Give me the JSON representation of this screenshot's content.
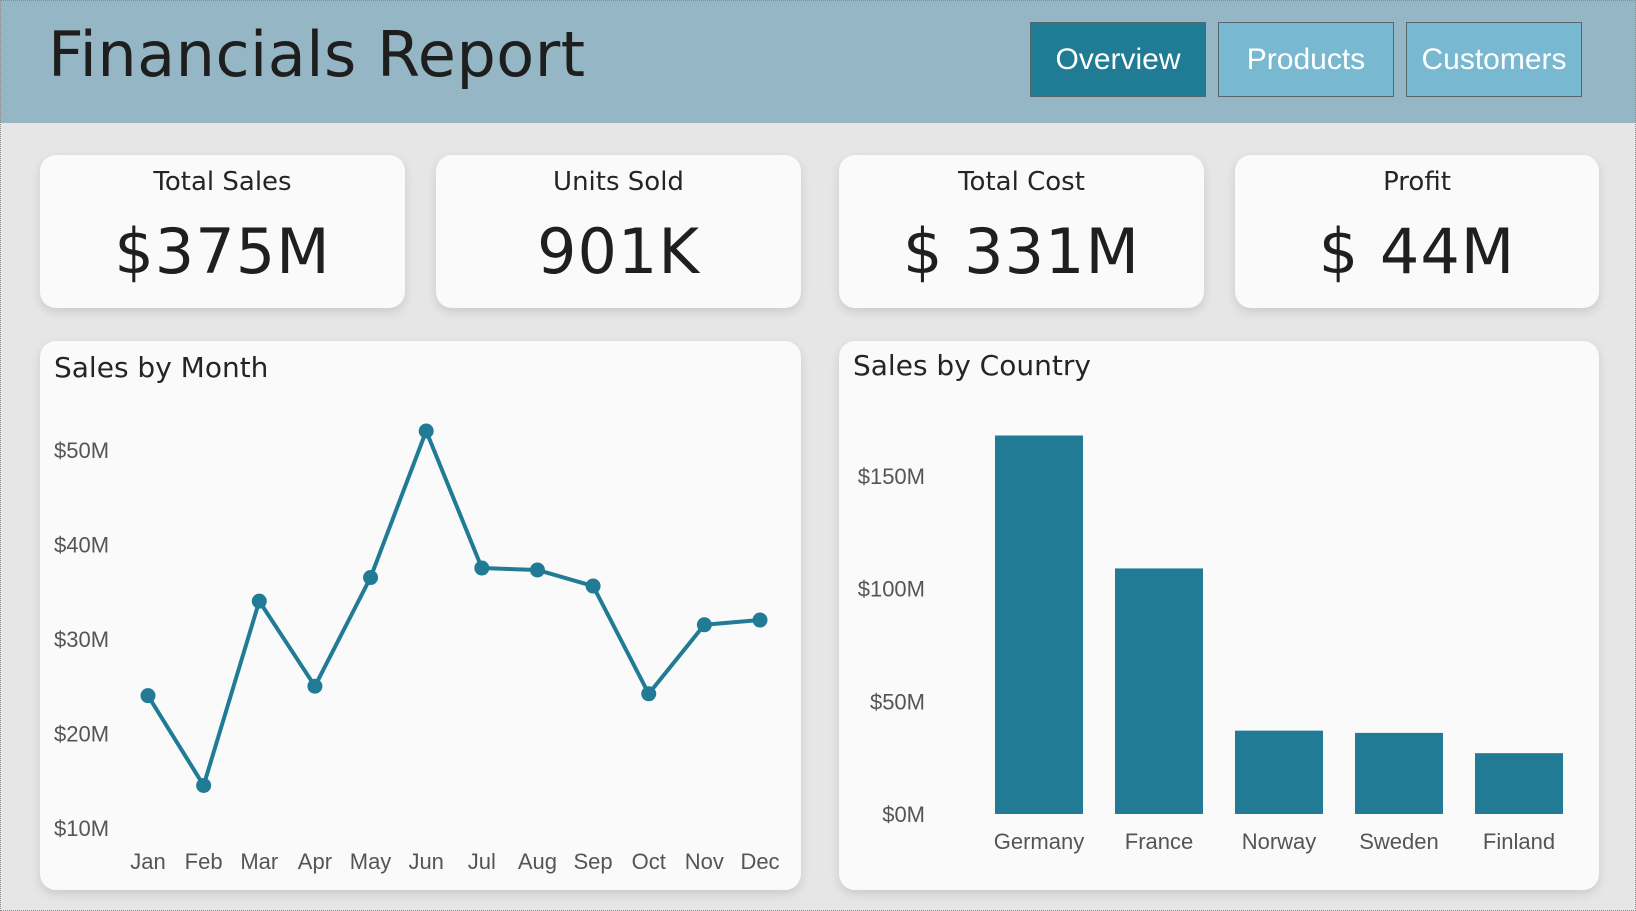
{
  "header": {
    "title": "Financials Report",
    "nav": [
      {
        "label": "Overview",
        "active": true
      },
      {
        "label": "Products",
        "active": false
      },
      {
        "label": "Customers",
        "active": false
      }
    ]
  },
  "kpis": [
    {
      "label": "Total Sales",
      "value": "$375M"
    },
    {
      "label": "Units Sold",
      "value": "901K"
    },
    {
      "label": "Total Cost",
      "value": "$ 331M"
    },
    {
      "label": "Profit",
      "value": "$ 44M"
    }
  ],
  "colors": {
    "accent": "#217b95",
    "header_bg": "#95b6c4",
    "nav_active": "#207b95",
    "nav_inactive": "#79b8d1",
    "page_bg": "#e6e6e6",
    "card_bg": "#fafafa"
  },
  "chart_data": [
    {
      "type": "line",
      "title": "Sales by Month",
      "x": [
        "Jan",
        "Feb",
        "Mar",
        "Apr",
        "May",
        "Jun",
        "Jul",
        "Aug",
        "Sep",
        "Oct",
        "Nov",
        "Dec"
      ],
      "values": [
        24.0,
        14.5,
        34.0,
        25.0,
        36.5,
        52.0,
        37.5,
        37.3,
        35.6,
        24.2,
        31.5,
        32.0
      ],
      "ylim": [
        10,
        52
      ],
      "yticks": [
        10,
        20,
        30,
        40,
        50
      ],
      "ytick_labels": [
        "$10M",
        "$20M",
        "$30M",
        "$40M",
        "$50M"
      ],
      "xlabel": "",
      "ylabel": "",
      "grid": false,
      "color": "#217b95"
    },
    {
      "type": "bar",
      "title": "Sales by Country",
      "categories": [
        "Germany",
        "France",
        "Norway",
        "Sweden",
        "Finland"
      ],
      "values": [
        168,
        109,
        37,
        36,
        27
      ],
      "ylim": [
        0,
        170
      ],
      "yticks": [
        0,
        50,
        100,
        150
      ],
      "ytick_labels": [
        "$0M",
        "$50M",
        "$100M",
        "$150M"
      ],
      "xlabel": "",
      "ylabel": "",
      "grid": false,
      "color": "#217b95"
    }
  ]
}
